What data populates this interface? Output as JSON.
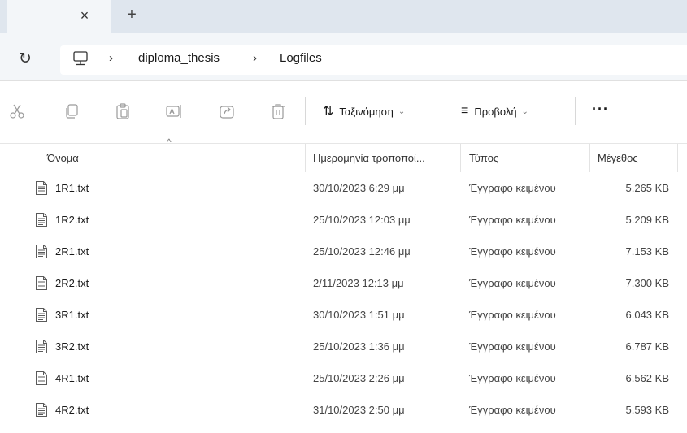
{
  "tabbar": {
    "close_glyph": "×",
    "new_tab_glyph": "+"
  },
  "address": {
    "refresh_glyph": "↻",
    "sep_glyph": "›",
    "crumbs": [
      "diploma_thesis",
      "Logfiles"
    ]
  },
  "commands": {
    "sort_label": "Ταξινόμηση",
    "sort_glyph": "⇅",
    "view_label": "Προβολή",
    "view_glyph": "≡",
    "chevron": "⌄",
    "more_glyph": "···"
  },
  "columns": {
    "name": "Όνομα",
    "date": "Ημερομηνία τροποποί...",
    "type": "Τύπος",
    "size": "Μέγεθος",
    "sort_indicator": "^"
  },
  "files": [
    {
      "name": "1R1.txt",
      "date": "30/10/2023 6:29 μμ",
      "type": "Έγγραφο κειμένου",
      "size": "5.265 KB"
    },
    {
      "name": "1R2.txt",
      "date": "25/10/2023 12:03 μμ",
      "type": "Έγγραφο κειμένου",
      "size": "5.209 KB"
    },
    {
      "name": "2R1.txt",
      "date": "25/10/2023 12:46 μμ",
      "type": "Έγγραφο κειμένου",
      "size": "7.153 KB"
    },
    {
      "name": "2R2.txt",
      "date": "2/11/2023 12:13 μμ",
      "type": "Έγγραφο κειμένου",
      "size": "7.300 KB"
    },
    {
      "name": "3R1.txt",
      "date": "30/10/2023 1:51 μμ",
      "type": "Έγγραφο κειμένου",
      "size": "6.043 KB"
    },
    {
      "name": "3R2.txt",
      "date": "25/10/2023 1:36 μμ",
      "type": "Έγγραφο κειμένου",
      "size": "6.787 KB"
    },
    {
      "name": "4R1.txt",
      "date": "25/10/2023 2:26 μμ",
      "type": "Έγγραφο κειμένου",
      "size": "6.562 KB"
    },
    {
      "name": "4R2.txt",
      "date": "31/10/2023 2:50 μμ",
      "type": "Έγγραφο κειμένου",
      "size": "5.593 KB"
    }
  ],
  "icons": {
    "tab_close": "close-icon",
    "new_tab": "plus-icon",
    "refresh": "refresh-icon",
    "this_pc": "computer-icon",
    "cut": "cut-icon",
    "copy": "copy-icon",
    "paste": "paste-icon",
    "rename": "rename-icon",
    "share": "share-icon",
    "delete": "delete-icon",
    "file": "text-file-icon"
  }
}
